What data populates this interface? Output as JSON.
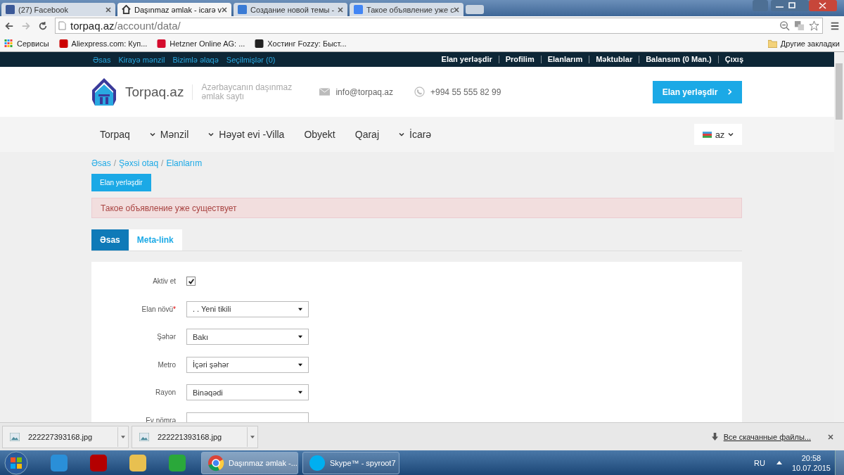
{
  "browser": {
    "tabs": [
      {
        "title": "(27) Facebook",
        "selected": false
      },
      {
        "title": "Daşınmaz əmlak - icarə v",
        "selected": true
      },
      {
        "title": "Создание новой темы -",
        "selected": false
      },
      {
        "title": "Такое объявление уже с",
        "selected": false
      }
    ],
    "url": {
      "host": "torpaq.az",
      "path": "/account/data/"
    },
    "bookmarks": [
      {
        "label": "Сервисы"
      },
      {
        "label": "Aliexpress.com: Куп..."
      },
      {
        "label": "Hetzner Online AG: ..."
      },
      {
        "label": "Хостинг Fozzy: Быст..."
      }
    ],
    "other_bookmarks": "Другие закладки"
  },
  "site": {
    "topbar": {
      "left_links": [
        "Əsas",
        "Kirayə mənzil",
        "Bizimlə əlaqə",
        "Seçilmişlər (0)"
      ],
      "right_links": [
        "Elan yerləşdir",
        "Profilim",
        "Elanlarım",
        "Məktublar",
        "Balansım (0 Man.)",
        "Çıxış"
      ]
    },
    "header": {
      "logo_text": "Torpaq.az",
      "tagline": [
        "Azərbaycanın daşınmaz",
        "əmlak saytı"
      ],
      "email": "info@torpaq.az",
      "phone": "+994 55 555 82 99",
      "cta": "Elan yerləşdir"
    },
    "nav": [
      {
        "label": "Torpaq",
        "dropdown": false
      },
      {
        "label": "Mənzil",
        "dropdown": true
      },
      {
        "label": "Həyət evi -Villa",
        "dropdown": true
      },
      {
        "label": "Obyekt",
        "dropdown": false
      },
      {
        "label": "Qaraj",
        "dropdown": false
      },
      {
        "label": "İcarə",
        "dropdown": true
      }
    ],
    "language": "az",
    "breadcrumbs": [
      "Əsas",
      "Şəxsi otaq",
      "Elanlarım"
    ],
    "breadcrumb_separator": "/",
    "post_button": "Elan yerləşdir",
    "alert": "Такое объявление уже существует",
    "form_tabs": [
      {
        "label": "Əsas",
        "selected": true
      },
      {
        "label": "Meta-link",
        "selected": false
      }
    ],
    "required_mark": "*",
    "fields": [
      {
        "label": "Aktiv et",
        "kind": "checkbox",
        "required": false,
        "checked": true
      },
      {
        "label": "Elan növü",
        "kind": "select",
        "required": true,
        "value": ". . Yeni tikili"
      },
      {
        "label": "Şəhər",
        "kind": "select",
        "required": false,
        "value": "Bakı"
      },
      {
        "label": "Metro",
        "kind": "select",
        "required": false,
        "value": "İçəri şəhər"
      },
      {
        "label": "Rayon",
        "kind": "select",
        "required": false,
        "value": "Binəqədi"
      },
      {
        "label": "Ev nömrə",
        "kind": "text",
        "required": false
      }
    ]
  },
  "downloads": {
    "files": [
      "222227393168.jpg",
      "222221393168.jpg"
    ],
    "all_link": "Все скачанные файлы..."
  },
  "taskbar": {
    "windows": [
      {
        "title": "Daşınmaz əmlak -...",
        "selected": true
      },
      {
        "title": "Skype™ - spyroot7",
        "selected": false
      }
    ],
    "language": "RU",
    "time": "20:58",
    "date": "10.07.2015"
  }
}
